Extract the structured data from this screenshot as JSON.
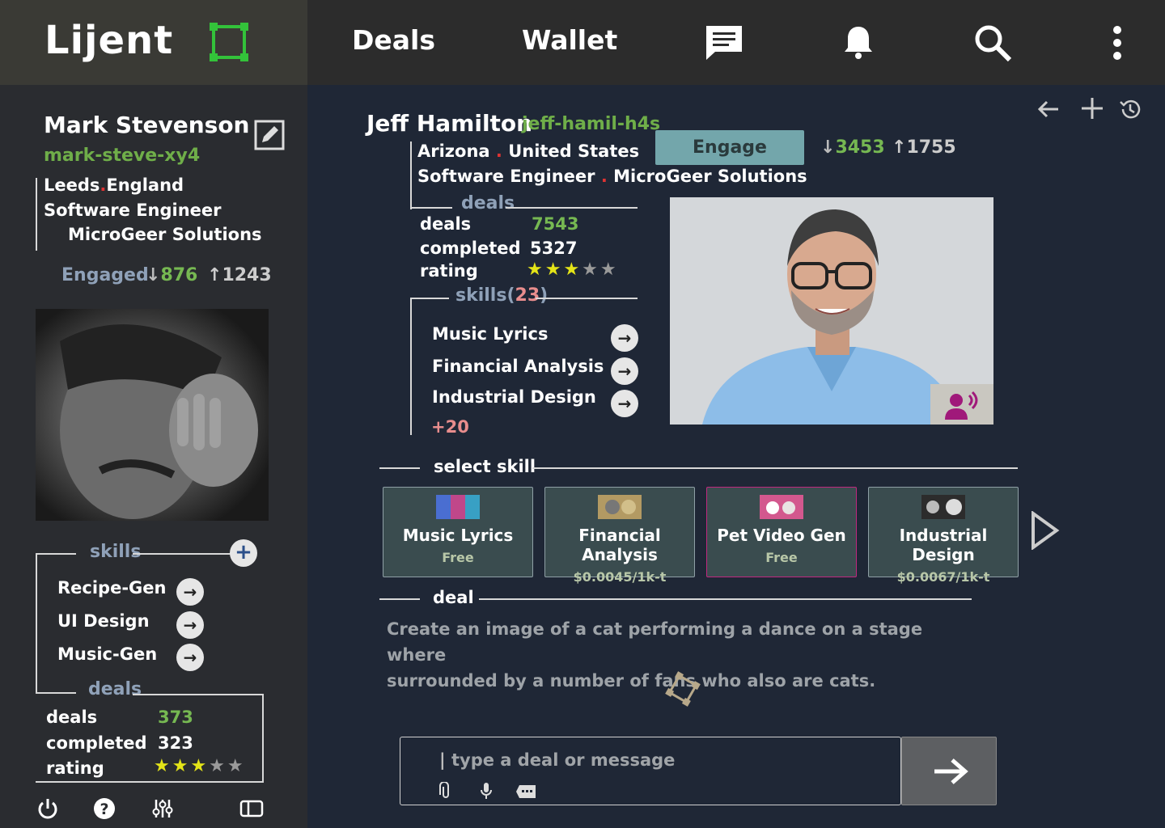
{
  "app": {
    "title": "Lijent"
  },
  "nav": {
    "deals": "Deals",
    "wallet": "Wallet"
  },
  "user": {
    "name": "Mark Stevenson",
    "handle": "mark-steve-xy4",
    "city": "Leeds",
    "country": "England",
    "title": "Software Engineer",
    "company": "MicroGeer Solutions",
    "status": "Engaged",
    "down": "876",
    "up": "1243",
    "skills_label": "skills",
    "skills": [
      "Recipe-Gen",
      "UI Design",
      "Music-Gen"
    ],
    "deals_label": "deals",
    "stats": {
      "deals_label": "deals",
      "deals": "373",
      "completed_label": "completed",
      "completed": "323",
      "rating_label": "rating",
      "rating": 3
    }
  },
  "profile": {
    "name": "Jeff Hamilton",
    "handle": "jeff-hamil-h4s",
    "region": "Arizona",
    "country": "United States",
    "title": "Software Engineer",
    "company": "MicroGeer Solutions",
    "engage_label": "Engage",
    "down": "3453",
    "up": "1755",
    "deals_label": "deals",
    "stats": {
      "deals_label": "deals",
      "deals": "7543",
      "completed_label": "completed",
      "completed": "5327",
      "rating_label": "rating",
      "rating": 3
    },
    "skills_label": "skills",
    "skills_count": "23",
    "skills": [
      "Music Lyrics",
      "Financial Analysis",
      "Industrial Design"
    ],
    "more": "+20"
  },
  "select_skill": {
    "label": "select skill",
    "cards": [
      {
        "title": "Music Lyrics",
        "price": "Free",
        "color": "#c0478a"
      },
      {
        "title": "Financial Analysis",
        "price": "$0.0045/1k-t",
        "color": "#b39a63"
      },
      {
        "title": "Pet Video Gen",
        "price": "Free",
        "color": "#d3588e",
        "selected": true
      },
      {
        "title": "Industrial Design",
        "price": "$0.0067/1k-t",
        "color": "#9a9a9a"
      }
    ]
  },
  "deal": {
    "label": "deal",
    "text_line1": "Create an image of a cat performing a dance on a stage where",
    "text_line2": "surrounded by a number of fans who also are cats."
  },
  "composer": {
    "placeholder": "type a deal or message"
  },
  "colors": {
    "accent_green": "#76b852",
    "engage_bg": "#73a6ab",
    "selected_border": "#c0287f"
  }
}
